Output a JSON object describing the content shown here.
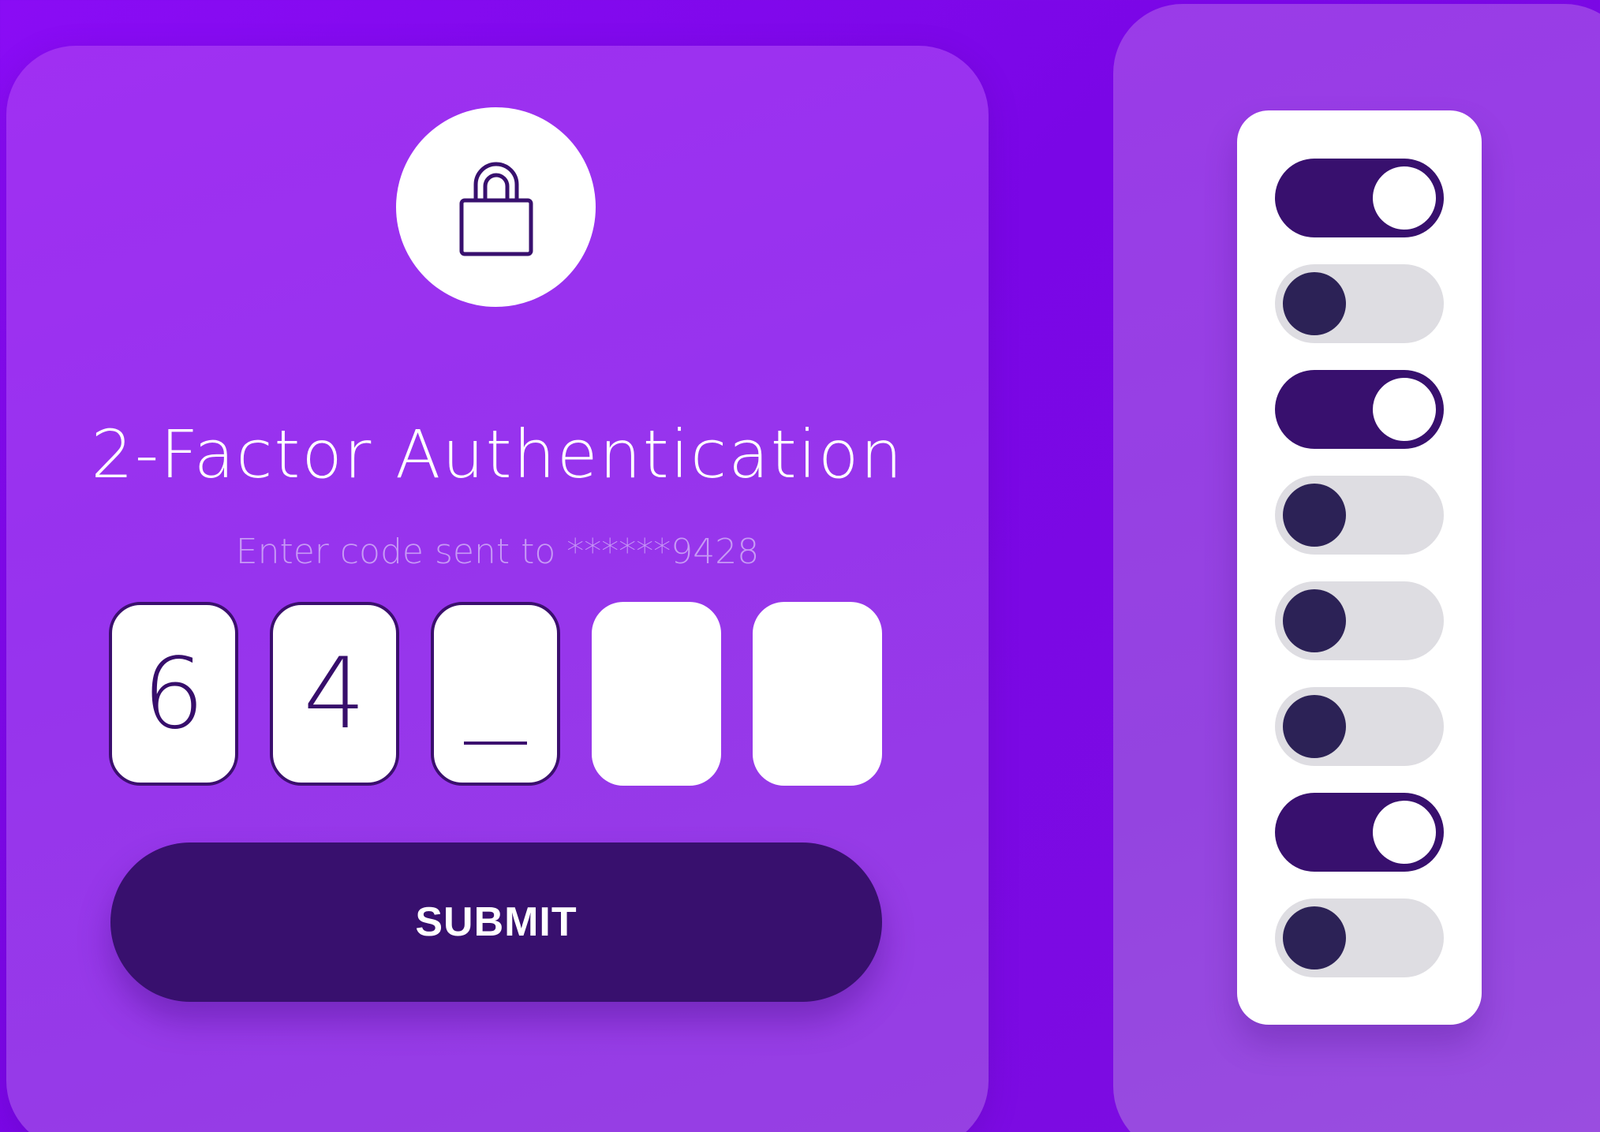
{
  "auth": {
    "title": "2-Factor Authentication",
    "subtitle": "Enter code sent to ******9428",
    "code_digits": [
      "6",
      "4",
      "",
      "",
      ""
    ],
    "active_index": 2,
    "submit_label": "SUBMIT"
  },
  "toggles": [
    {
      "state": "on"
    },
    {
      "state": "off"
    },
    {
      "state": "on"
    },
    {
      "state": "off"
    },
    {
      "state": "off"
    },
    {
      "state": "off"
    },
    {
      "state": "on"
    },
    {
      "state": "off"
    }
  ],
  "colors": {
    "background": "#7a06e6",
    "card": "#9733ee",
    "accent_dark": "#38106e",
    "toggle_off_track": "#dedde2",
    "toggle_off_knob": "#2c2256",
    "subtitle_text": "#c79af5"
  },
  "icons": {
    "lock": "lock-icon"
  }
}
